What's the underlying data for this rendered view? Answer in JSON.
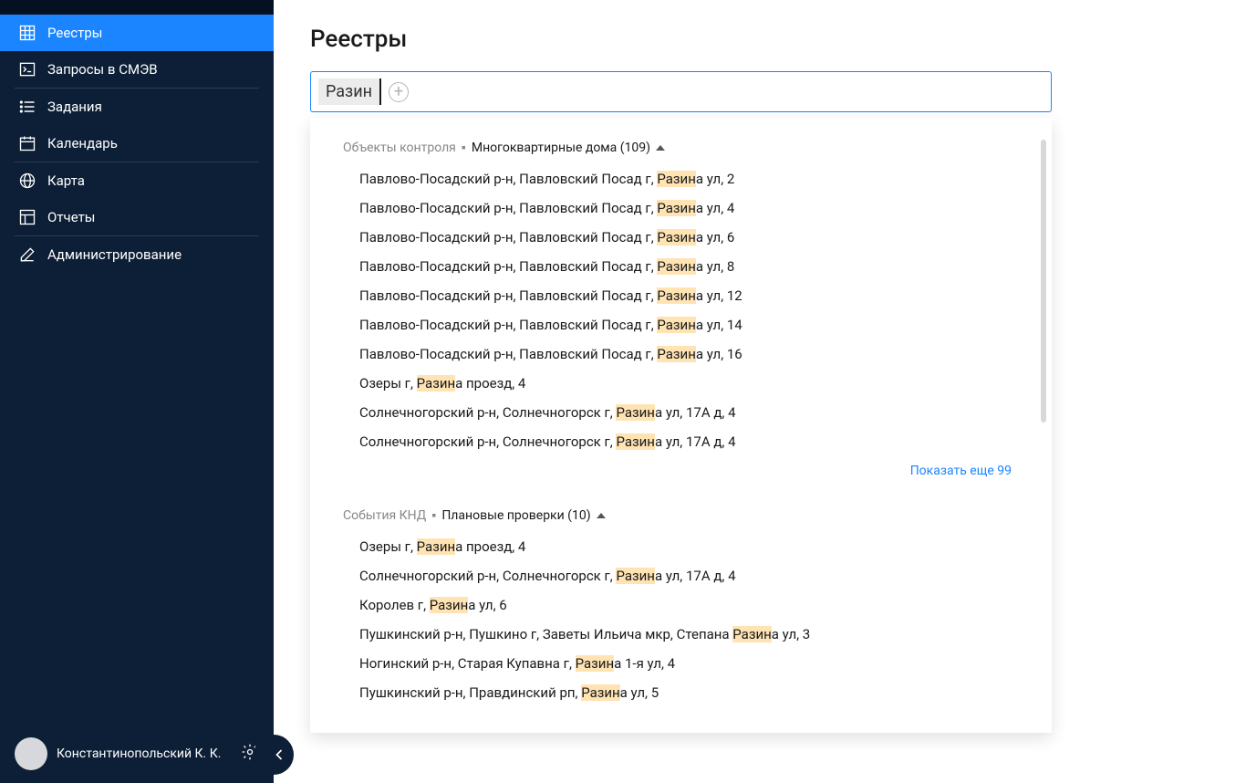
{
  "sidebar": {
    "items": [
      {
        "label": "Реестры",
        "active": true
      },
      {
        "label": "Запросы в СМЭВ",
        "active": false
      },
      {
        "label": "Задания",
        "active": false
      },
      {
        "label": "Календарь",
        "active": false
      },
      {
        "label": "Карта",
        "active": false
      },
      {
        "label": "Отчеты",
        "active": false
      },
      {
        "label": "Администрирование",
        "active": false
      }
    ],
    "user": {
      "name": "Константинопольский К. К."
    }
  },
  "main": {
    "title": "Реестры",
    "search": {
      "chip": "Разин",
      "highlight": "Разин"
    },
    "groups": [
      {
        "prefix": "Объекты контроля",
        "title": "Многоквартирные дома (109)",
        "show_more": "Показать еще 99",
        "items": [
          "Павлово-Посадский р-н, Павловский Посад г, Разина ул, 2",
          "Павлово-Посадский р-н, Павловский Посад г, Разина ул, 4",
          "Павлово-Посадский р-н, Павловский Посад г, Разина ул, 6",
          "Павлово-Посадский р-н, Павловский Посад г, Разина ул, 8",
          "Павлово-Посадский р-н, Павловский Посад г, Разина ул, 12",
          "Павлово-Посадский р-н, Павловский Посад г, Разина ул, 14",
          "Павлово-Посадский р-н, Павловский Посад г, Разина ул, 16",
          "Озеры г, Разина проезд, 4",
          "Солнечногорский р-н, Солнечногорск г, Разина ул, 17А д, 4",
          "Солнечногорский р-н, Солнечногорск г, Разина ул, 17А д, 4"
        ]
      },
      {
        "prefix": "События КНД",
        "title": "Плановые проверки (10)",
        "items": [
          "Озеры г, Разина проезд, 4",
          "Солнечногорский р-н, Солнечногорск г, Разина ул, 17А д, 4",
          "Королев г, Разина ул, 6",
          "Пушкинский р-н, Пушкино г, Заветы Ильича мкр, Степана Разина ул, 3",
          "Ногинский р-н, Старая Купавна г, Разина 1-я ул, 4",
          "Пушкинский р-н, Правдинский рп, Разина ул, 5"
        ]
      }
    ]
  }
}
